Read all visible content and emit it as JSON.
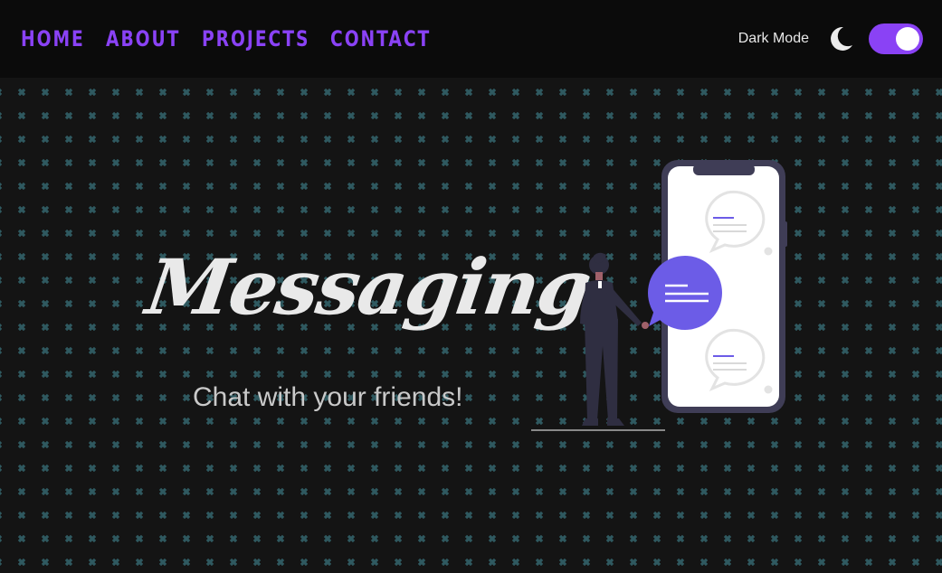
{
  "nav": {
    "links": [
      "HOME",
      "ABOUT",
      "PROJECTS",
      "CONTACT"
    ]
  },
  "controls": {
    "mode_label": "Dark Mode",
    "dark_mode_on": true,
    "icon": "moon-icon"
  },
  "hero": {
    "title": "Messaging",
    "subtitle": "Chat with your friends!"
  },
  "colors": {
    "accent": "#8a42f5",
    "background": "#141414",
    "navbar": "#0b0b0b",
    "pattern": "#2f5960",
    "bubble": "#6c5ce7"
  }
}
